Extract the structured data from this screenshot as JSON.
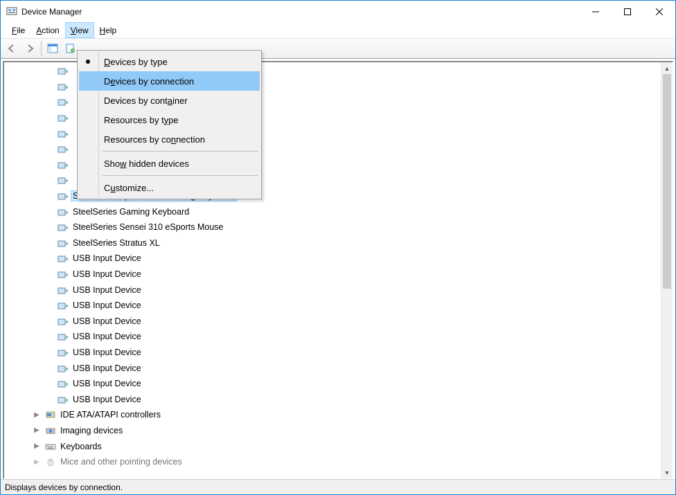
{
  "title": "Device Manager",
  "menubar": {
    "file": "File",
    "action": "Action",
    "view": "View",
    "help": "Help"
  },
  "dropdown": {
    "devices_by_type": "Devices by type",
    "devices_by_connection": "Devices by connection",
    "devices_by_container": "Devices by container",
    "resources_by_type": "Resources by type",
    "resources_by_connection": "Resources by connection",
    "show_hidden": "Show hidden devices",
    "customize": "Customize..."
  },
  "devices": {
    "hidden_top": [
      "",
      "",
      "",
      "",
      "",
      "",
      "",
      ""
    ],
    "selected": "SteelSeries Apex M750 Gaming Keyboard",
    "items": [
      "SteelSeries Gaming Keyboard",
      "SteelSeries Sensei 310 eSports Mouse",
      "SteelSeries Stratus XL",
      "USB Input Device",
      "USB Input Device",
      "USB Input Device",
      "USB Input Device",
      "USB Input Device",
      "USB Input Device",
      "USB Input Device",
      "USB Input Device",
      "USB Input Device",
      "USB Input Device"
    ],
    "categories": [
      "IDE ATA/ATAPI controllers",
      "Imaging devices",
      "Keyboards",
      "Mice and other pointing devices"
    ]
  },
  "status": "Displays devices by connection."
}
